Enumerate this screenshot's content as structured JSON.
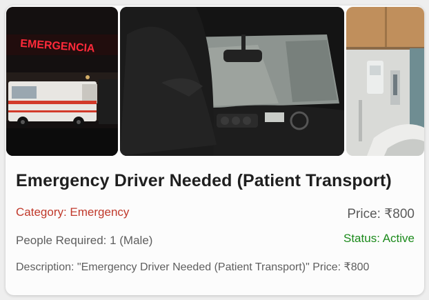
{
  "images": {
    "photo1": {
      "sign_text": "EMERGENCIA",
      "subject": "ambulance"
    },
    "photo2": {
      "subject": "driver-interior"
    },
    "photo3": {
      "subject": "hospital-room"
    }
  },
  "listing": {
    "title": "Emergency Driver Needed (Patient Transport)",
    "category": "Category: Emergency",
    "price": "Price: ₹800",
    "people": "People Required: 1 (Male)",
    "status": "Status: Active",
    "description": "Description: \"Emergency Driver Needed (Patient Transport)\" Price: ₹800"
  },
  "colors": {
    "category": "#c0392b",
    "status": "#1b8a1b",
    "emergency_sign": "#ff2a3a"
  }
}
